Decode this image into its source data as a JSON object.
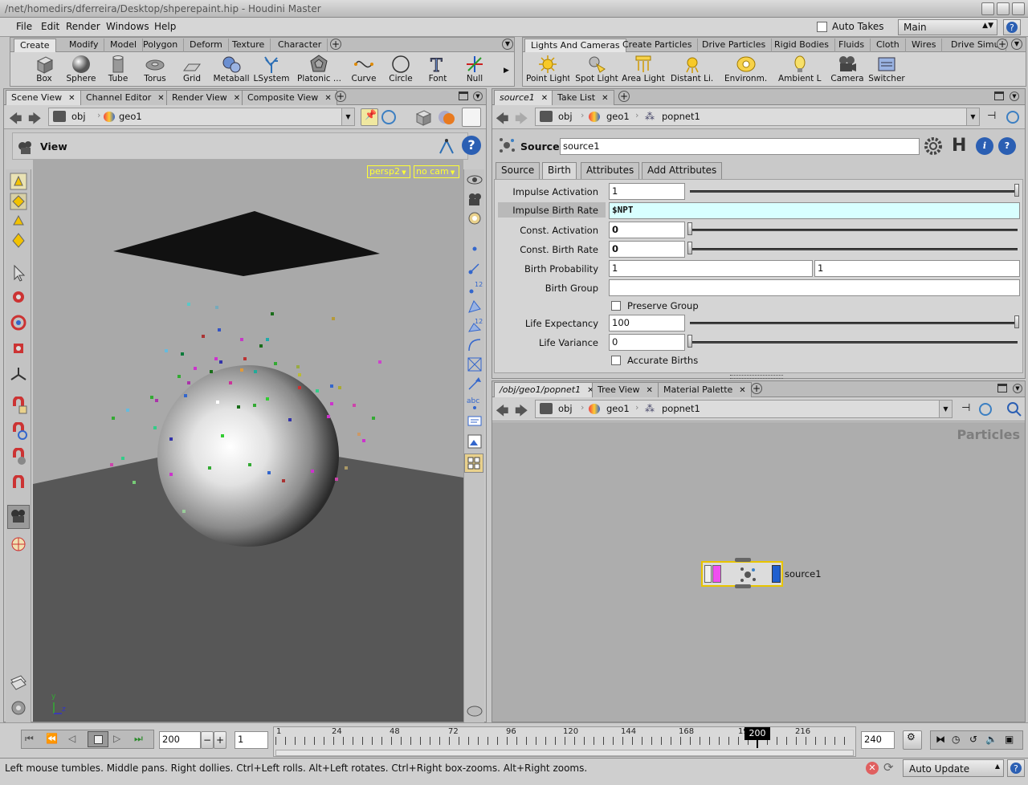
{
  "window": {
    "title": "/net/homedirs/dferreira/Desktop/shperepaint.hip - Houdini Master"
  },
  "menubar": {
    "items": [
      "File",
      "Edit",
      "Render",
      "Windows",
      "Help"
    ],
    "auto_takes": "Auto Takes",
    "take": "Main"
  },
  "shelf_left": {
    "tabs": [
      "Create",
      "Modify",
      "Model",
      "Polygon",
      "Deform",
      "Texture",
      "Character"
    ],
    "tools": [
      "Box",
      "Sphere",
      "Tube",
      "Torus",
      "Grid",
      "Metaball",
      "LSystem",
      "Platonic ...",
      "Curve",
      "Circle",
      "Font",
      "Null"
    ]
  },
  "shelf_right": {
    "tabs": [
      "Lights And Cameras",
      "Create Particles",
      "Drive Particles",
      "Rigid Bodies",
      "Fluids",
      "Cloth",
      "Wires",
      "Drive Simu"
    ],
    "tools": [
      "Point Light",
      "Spot Light",
      "Area Light",
      "Distant Li...",
      "Environm...",
      "Ambient L...",
      "Camera",
      "Switcher"
    ]
  },
  "scene_pane": {
    "tabs": [
      "Scene View",
      "Channel Editor",
      "Render View",
      "Composite View"
    ],
    "path": [
      "obj",
      "geo1"
    ],
    "view_label": "View",
    "camera": "persp2",
    "cam": "no cam",
    "axis_y": "y",
    "axis_z": "z"
  },
  "param_pane": {
    "tabs": [
      "source1",
      "Take List"
    ],
    "path": [
      "obj",
      "geo1",
      "popnet1"
    ],
    "op_type": "Source",
    "op_name": "source1",
    "subtabs": [
      "Source",
      "Birth",
      "Attributes",
      "Add Attributes"
    ],
    "params": {
      "impulse_activation": {
        "label": "Impulse Activation",
        "value": "1"
      },
      "impulse_birth_rate": {
        "label": "Impulse Birth Rate",
        "value": "$NPT"
      },
      "const_activation": {
        "label": "Const. Activation",
        "value": "0"
      },
      "const_birth_rate": {
        "label": "Const. Birth Rate",
        "value": "0"
      },
      "birth_probability": {
        "label": "Birth Probability",
        "value1": "1",
        "value2": "1"
      },
      "birth_group": {
        "label": "Birth Group",
        "value": ""
      },
      "preserve_group": {
        "label": "Preserve Group"
      },
      "life_expectancy": {
        "label": "Life Expectancy",
        "value": "100"
      },
      "life_variance": {
        "label": "Life Variance",
        "value": "0"
      },
      "accurate_births": {
        "label": "Accurate Births"
      }
    }
  },
  "network_pane": {
    "tabs": [
      "/obj/geo1/popnet1",
      "Tree View",
      "Material Palette"
    ],
    "path": [
      "obj",
      "geo1",
      "popnet1"
    ],
    "context": "Particles",
    "node_name": "source1"
  },
  "timeline": {
    "frame": "200",
    "start": "1",
    "end": "240",
    "ticks": [
      "1",
      "24",
      "48",
      "72",
      "96",
      "120",
      "144",
      "168",
      "192",
      "216"
    ],
    "current": "200"
  },
  "status": {
    "message": "Left mouse tumbles. Middle pans. Right dollies. Ctrl+Left rolls. Alt+Left rotates. Ctrl+Right box-zooms. Alt+Right zooms.",
    "update_mode": "Auto Update"
  },
  "colors": {
    "accent_yellow": "#ffff33",
    "highlight_field": "#d8ffff",
    "node_outline": "#e8c400"
  }
}
